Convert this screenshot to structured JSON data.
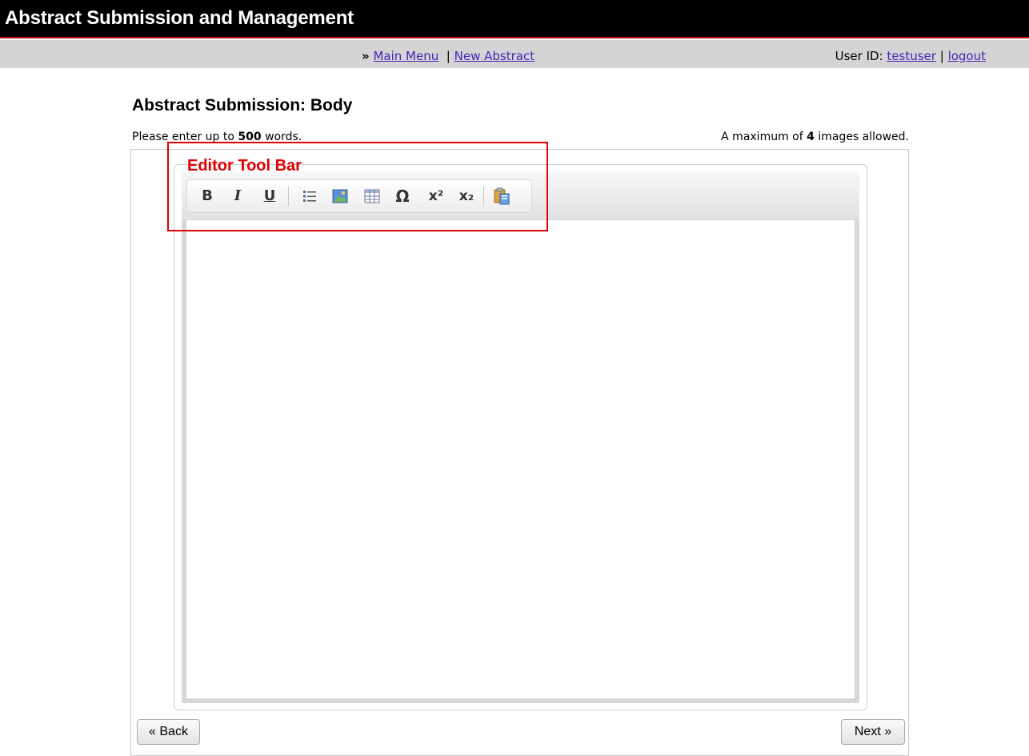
{
  "app": {
    "title": "Abstract Submission and Management"
  },
  "nav": {
    "prefix": "»",
    "main_menu": "Main Menu",
    "separator": "|",
    "new_abstract": "New Abstract",
    "user_id_label": "User ID:",
    "user_id": "testuser",
    "user_separator": "|",
    "logout": "logout"
  },
  "page": {
    "heading": "Abstract Submission: Body",
    "hint_left_pre": "Please enter up to ",
    "word_limit": "500",
    "hint_left_post": " words.",
    "hint_right_pre": "A maximum of ",
    "image_limit": "4",
    "hint_right_post": " images allowed."
  },
  "editor": {
    "toolbar_buttons": [
      {
        "name": "bold",
        "glyph": "B"
      },
      {
        "name": "italic",
        "glyph": "I"
      },
      {
        "name": "underline",
        "glyph": "U"
      },
      {
        "name": "bulleted-list",
        "glyph": "list-icon"
      },
      {
        "name": "insert-image",
        "glyph": "image-icon"
      },
      {
        "name": "insert-table",
        "glyph": "table-icon"
      },
      {
        "name": "special-character",
        "glyph": "Ω"
      },
      {
        "name": "superscript",
        "glyph": "x²"
      },
      {
        "name": "subscript",
        "glyph": "x₂"
      },
      {
        "name": "paste",
        "glyph": "paste-icon"
      }
    ],
    "content": ""
  },
  "buttons": {
    "back": "« Back",
    "next": "Next »"
  },
  "annotation": {
    "label": "Editor Tool Bar",
    "color": "#e00000"
  },
  "colors": {
    "titlebar_bg": "#000000",
    "accent": "#c00000",
    "link": "#4a22b8",
    "navbar_bg": "#d4d4d4"
  }
}
